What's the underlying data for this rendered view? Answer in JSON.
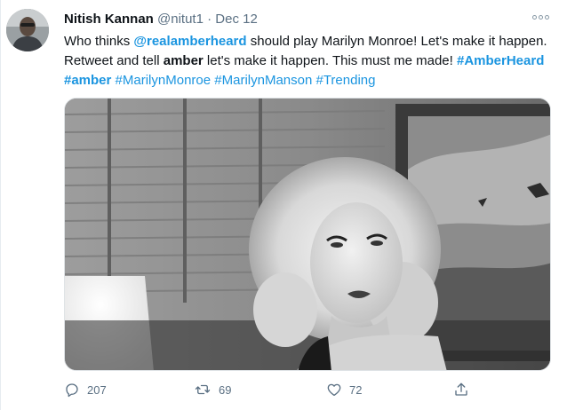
{
  "tweet": {
    "author_name": "Nitish Kannan",
    "handle": "@nitut1",
    "separator": "·",
    "date": "Dec 12",
    "text": {
      "t1": "Who thinks ",
      "mention": "@realamberheard",
      "t2": " should play Marilyn Monroe! Let's make it happen. Retweet and tell ",
      "bold_word": "amber",
      "t3": " let's make it happen. This must me made! ",
      "hashtags": [
        "#AmberHeard",
        "#amber",
        "#MarilynMonroe",
        "#MarilynManson",
        "#Trending"
      ]
    },
    "media_icon": "photo-of-woman-with-blonde-curls",
    "avatar_icon": "profile-photo",
    "accent_color": "#1b95e0"
  },
  "actions": {
    "reply_count": "207",
    "retweet_count": "69",
    "like_count": "72",
    "reply_icon": "reply-icon",
    "retweet_icon": "retweet-icon",
    "like_icon": "heart-icon",
    "share_icon": "share-icon"
  }
}
